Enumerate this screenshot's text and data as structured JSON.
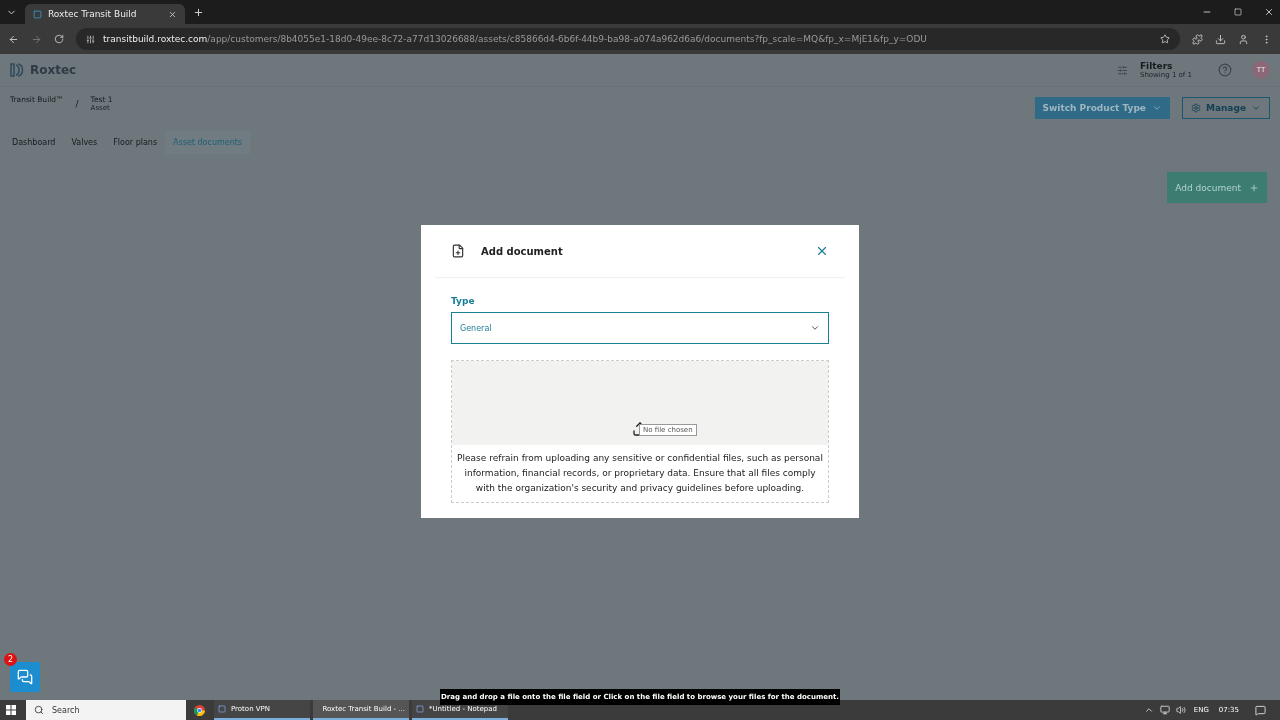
{
  "browser": {
    "tab_title": "Roxtec Transit Build",
    "url_host": "transitbuild.roxtec.com",
    "url_path": "/app/customers/8b4055e1-18d0-49ee-8c72-a77d13026688/assets/c85866d4-6b6f-44b9-ba98-a074a962d6a6/documents?fp_scale=MQ&fp_x=MjE1&fp_y=ODU"
  },
  "app": {
    "logo": "Roxtec",
    "filters": {
      "label": "Filters",
      "sublabel": "Showing 1 of 1"
    },
    "avatar": "TT",
    "breadcrumb_separator": "/",
    "breadcrumb": [
      {
        "title": "Transit Build™"
      },
      {
        "title": "Test 1",
        "subtitle": "Asset"
      }
    ],
    "tabs": [
      {
        "label": "Dashboard",
        "selected": false
      },
      {
        "label": "Valves",
        "selected": false
      },
      {
        "label": "Floor plans",
        "selected": false
      },
      {
        "label": "Asset documents",
        "selected": true
      }
    ],
    "switch_button": "Switch Product Type",
    "manage_button": "Manage",
    "add_button": "Add document"
  },
  "dialog": {
    "title": "Add document",
    "type_label": "Type",
    "type_value": "General",
    "file_status": "No file chosen",
    "notice": "Please refrain from uploading any sensitive or confidential files, such as personal information, financial records, or proprietary data. Ensure that all files comply with the organization's security and privacy guidelines before uploading."
  },
  "tooltip": "Drag and drop a file onto the file field or Click on the file field to browse your files for the document.",
  "chat_badge": "2",
  "taskbar": {
    "search": "Search",
    "apps": [
      {
        "label": "Proton VPN",
        "active": false
      },
      {
        "label": "Roxtec Transit Build - ...",
        "active": true
      },
      {
        "label": "*Untitled - Notepad",
        "active": false
      }
    ],
    "language": "ENG",
    "time": "07:35"
  }
}
